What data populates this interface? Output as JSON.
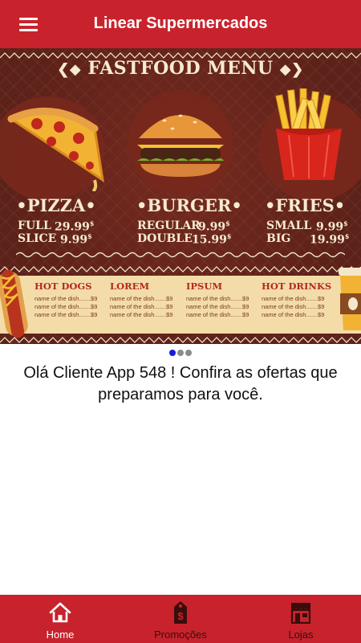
{
  "header": {
    "menu_icon": "hamburger-icon",
    "title": "Linear Supermercados"
  },
  "banner": {
    "menu_title": "FASTFOOD MENU",
    "columns": [
      {
        "name": "•PIZZA•",
        "prices": [
          {
            "label": "FULL",
            "price": "29.99",
            "currency": "$"
          },
          {
            "label": "SLICE",
            "price": "9.99",
            "currency": "$"
          }
        ]
      },
      {
        "name": "•BURGER•",
        "prices": [
          {
            "label": "REGULAR",
            "price": "9.99",
            "currency": "$"
          },
          {
            "label": "DOUBLE",
            "price": "15.99",
            "currency": "$"
          }
        ]
      },
      {
        "name": "•FRIES•",
        "prices": [
          {
            "label": "SMALL",
            "price": "9.99",
            "currency": "$"
          },
          {
            "label": "BIG",
            "price": "19.99",
            "currency": "$"
          }
        ]
      }
    ],
    "strip": [
      {
        "heading": "HOT DOGS",
        "lines": [
          "name of the dish.......$9",
          "name of the dish.......$9",
          "name of the dish.......$9"
        ]
      },
      {
        "heading": "LOREM",
        "lines": [
          "name of the dish.......$9",
          "name of the dish.......$9",
          "name of the dish.......$9"
        ]
      },
      {
        "heading": "IPSUM",
        "lines": [
          "name of the dish.......$9",
          "name of the dish.......$9",
          "name of the dish.......$9"
        ]
      },
      {
        "heading": "HOT DRINKS",
        "lines": [
          "name of the dish.......$9",
          "name of the dish.......$9",
          "name of the dish.......$9"
        ]
      }
    ]
  },
  "carousel": {
    "total": 3,
    "active": 1
  },
  "greeting": "Olá Cliente App 548 ! Confira as ofertas que preparamos para você.",
  "bottom_nav": {
    "items": [
      {
        "label": "Home",
        "icon": "home-icon",
        "active": true
      },
      {
        "label": "Promoções",
        "icon": "price-tag-icon",
        "active": false
      },
      {
        "label": "Lojas",
        "icon": "store-icon",
        "active": false
      }
    ]
  },
  "colors": {
    "primary": "#c8232c",
    "banner_bg": "#5c2119",
    "dot_active": "#1a1adb",
    "dot_inactive": "#8a8a8a"
  }
}
